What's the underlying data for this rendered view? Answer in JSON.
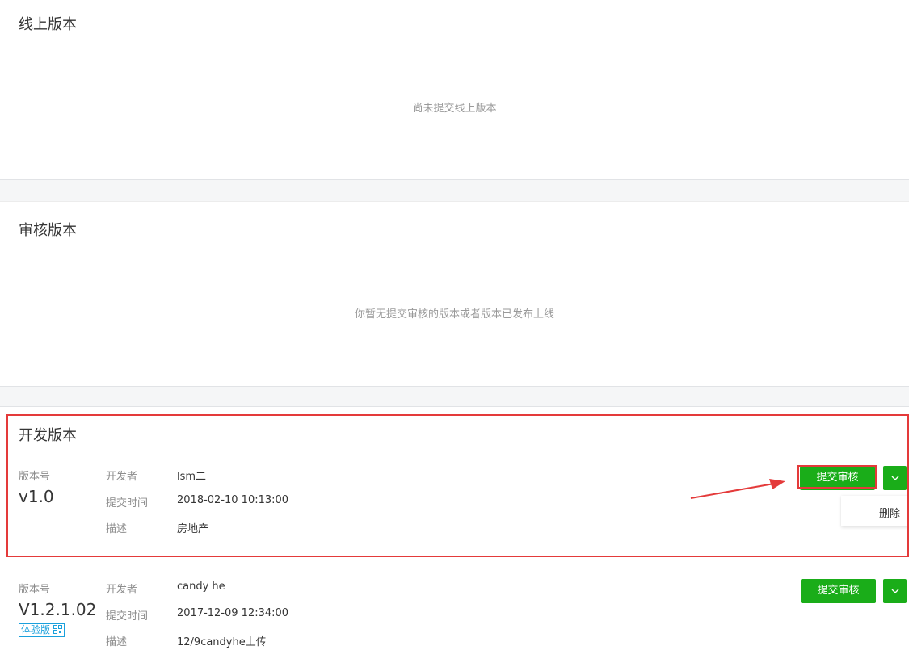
{
  "online": {
    "title": "线上版本",
    "empty_tip": "尚未提交线上版本"
  },
  "review": {
    "title": "审核版本",
    "empty_tip": "你暂无提交审核的版本或者版本已发布上线"
  },
  "dev": {
    "title": "开发版本",
    "labels": {
      "version": "版本号",
      "developer": "开发者",
      "submit_time": "提交时间",
      "description": "描述"
    },
    "versions": [
      {
        "version": "v1.0",
        "developer": "lsm二",
        "submit_time": "2018-02-10 10:13:00",
        "description": "房地产",
        "submit_label": "提交审核",
        "dropdown_item": "删除"
      },
      {
        "version": "V1.2.1.02",
        "tag": "体验版",
        "developer": "candy he",
        "submit_time": "2017-12-09 12:34:00",
        "description": "12/9candyhe上传",
        "submit_label": "提交审核"
      }
    ]
  },
  "colors": {
    "primary_green": "#1aad19",
    "annotation_red": "#e43a3a",
    "tag_blue": "#1aa0dc"
  },
  "icons": {
    "dropdown": "chevron-down-icon",
    "tag_qr": "qrcode-icon",
    "annotation": "red-arrow-icon"
  }
}
